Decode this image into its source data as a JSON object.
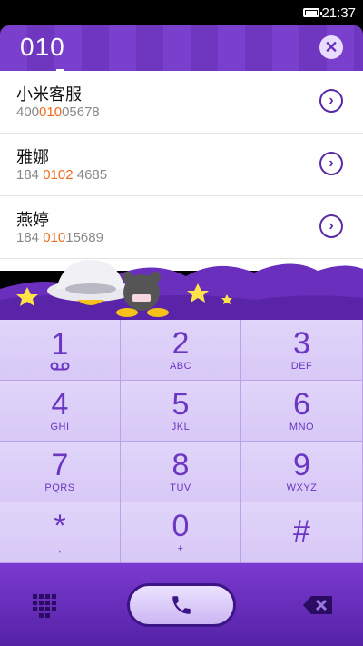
{
  "status": {
    "time": "21:37"
  },
  "dial": {
    "number": "010"
  },
  "results": [
    {
      "name": "小米客服",
      "pre": "400",
      "hl": "010",
      "post": "05678"
    },
    {
      "name": "雅娜",
      "pre": "184 ",
      "hl": "0102",
      "post": " 4685"
    },
    {
      "name": "燕婷",
      "pre": "184 ",
      "hl": "010",
      "post": "15689"
    }
  ],
  "keys": [
    {
      "digit": "1",
      "letters": ""
    },
    {
      "digit": "2",
      "letters": "ABC"
    },
    {
      "digit": "3",
      "letters": "DEF"
    },
    {
      "digit": "4",
      "letters": "GHI"
    },
    {
      "digit": "5",
      "letters": "JKL"
    },
    {
      "digit": "6",
      "letters": "MNO"
    },
    {
      "digit": "7",
      "letters": "PQRS"
    },
    {
      "digit": "8",
      "letters": "TUV"
    },
    {
      "digit": "9",
      "letters": "WXYZ"
    },
    {
      "digit": "*",
      "letters": ","
    },
    {
      "digit": "0",
      "letters": "+"
    },
    {
      "digit": "#",
      "letters": ""
    }
  ],
  "icons": {
    "battery": "battery-icon",
    "clear": "clear-icon",
    "arrow": "chevron-right-icon",
    "voicemail": "voicemail-icon",
    "keypad": "keypad-grid-icon",
    "call": "phone-icon",
    "delete": "backspace-icon"
  },
  "colors": {
    "accent": "#6f37c0",
    "keypad": "#d7c8f6",
    "highlight": "#f06a1e"
  }
}
